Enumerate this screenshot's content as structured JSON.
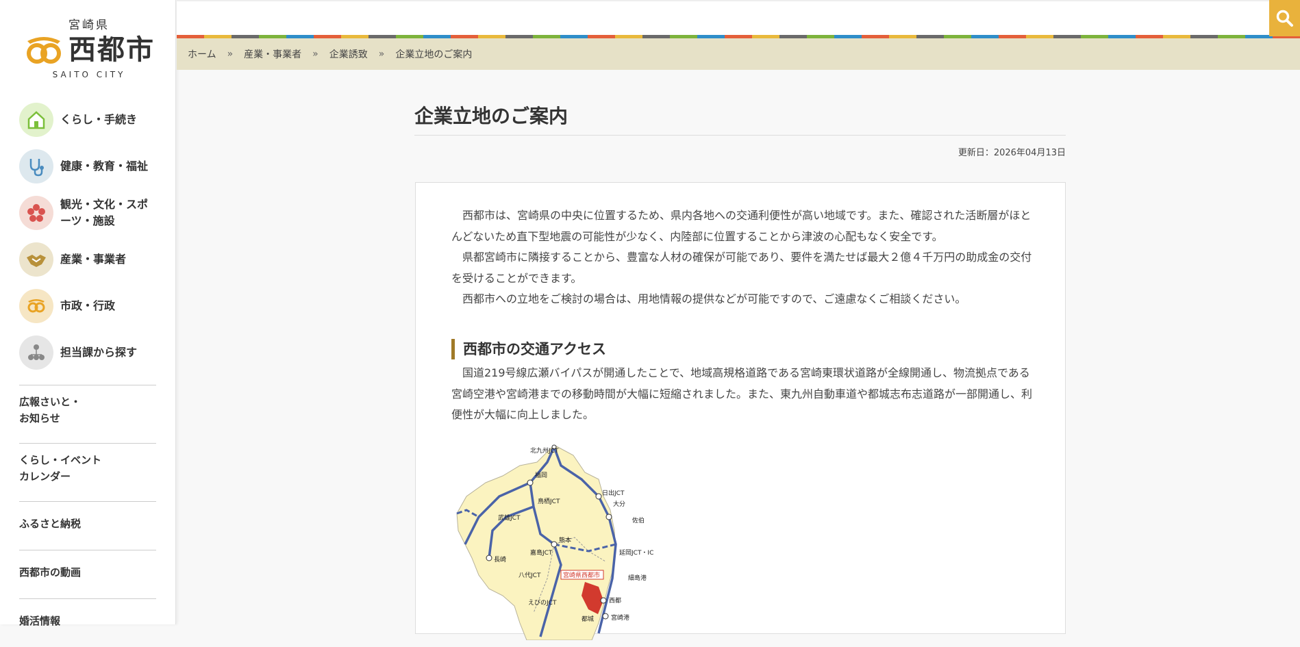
{
  "logo": {
    "prefecture": "宮崎県",
    "city": "西都市",
    "english": "SAITO CITY"
  },
  "sidebar": {
    "items": [
      {
        "label": "くらし・手続き",
        "icon": "house-icon",
        "color": "#e0f0c8"
      },
      {
        "label": "健康・教育・福祉",
        "icon": "stethoscope-icon",
        "color": "#dde8ee"
      },
      {
        "label": "観光・文化・スポーツ・施設",
        "icon": "flower-icon",
        "color": "#f5dcd6"
      },
      {
        "label": "産業・事業者",
        "icon": "handshake-icon",
        "color": "#ece4cc"
      },
      {
        "label": "市政・行政",
        "icon": "city-emblem-icon",
        "color": "#f6e6c4"
      },
      {
        "label": "担当課から探す",
        "icon": "org-chart-icon",
        "color": "#e6e6e6"
      }
    ],
    "sub_items": [
      "広報さいと・\nお知らせ",
      "くらし・イベント\nカレンダー",
      "ふるさと納税",
      "西都市の動画",
      "婚活情報"
    ]
  },
  "header": {
    "search_icon": "search-icon",
    "accent_color": "#e9b23c"
  },
  "breadcrumb": [
    "ホーム",
    "産業・事業者",
    "企業誘致",
    "企業立地のご案内"
  ],
  "breadcrumb_separator": "»",
  "page": {
    "title": "企業立地のご案内",
    "updated": "更新日：2026年04月13日",
    "paragraphs": [
      "西都市は、宮崎県の中央に位置するため、県内各地への交通利便性が高い地域です。また、確認された活断層がほとんどないため直下型地震の可能性が少なく、内陸部に位置することから津波の心配もなく安全です。",
      "県都宮崎市に隣接することから、豊富な人材の確保が可能であり、要件を満たせば最大２億４千万円の助成金の交付を受けることができます。",
      "西都市への立地をご検討の場合は、用地情報の提供などが可能ですので、ご遠慮なくご相談ください。"
    ],
    "section_heading": "西都市の交通アクセス",
    "section_paragraph": "国道219号線広瀬バイパスが開通したことで、地域高規格道路である宮崎東環状道路が全線開通し、物流拠点である宮崎空港や宮崎港までの移動時間が大幅に短縮されました。また、東九州自動車道や都城志布志道路が一部開通し、利便性が大幅に向上しました。",
    "map": {
      "labels": [
        "北九州JCT",
        "福岡",
        "日出JCT",
        "大分",
        "鳥栖JCT",
        "佐伯",
        "武雄JCT",
        "熊本",
        "嘉島JCT",
        "延岡JCT・IC",
        "長崎",
        "八代JCT",
        "細島港",
        "西都",
        "えびのJCT",
        "都城",
        "宮崎港"
      ],
      "highlight": "宮崎県西都市",
      "highlight_color": "#d23a2e"
    }
  }
}
